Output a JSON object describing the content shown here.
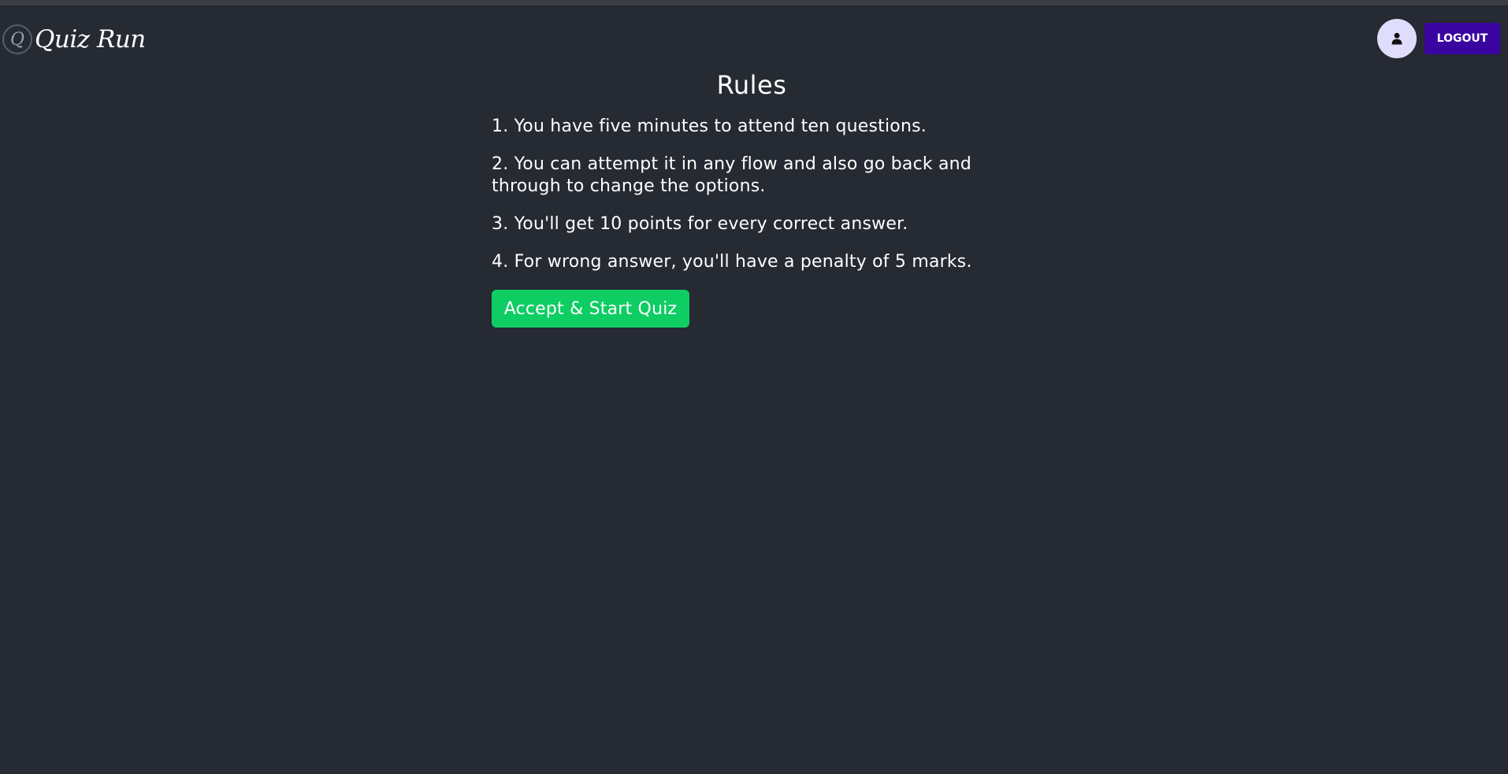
{
  "navbar": {
    "brand_initial": "Q",
    "brand_name": "Quiz Run",
    "avatar_icon": "user-icon",
    "logout_label": "LOGOUT"
  },
  "rules": {
    "title": "Rules",
    "items": [
      "1. You have five minutes to attend ten questions.",
      "2. You can attempt it in any flow and also go back and through to change the options.",
      "3. You'll get 10 points for every correct answer.",
      "4. For wrong answer, you'll have a penalty of 5 marks."
    ],
    "start_label": "Accept & Start Quiz"
  },
  "colors": {
    "background": "#252a33",
    "logout_button": "#3a04a0",
    "start_button": "#0ecd63",
    "avatar_bg": "#e0dcfb"
  }
}
